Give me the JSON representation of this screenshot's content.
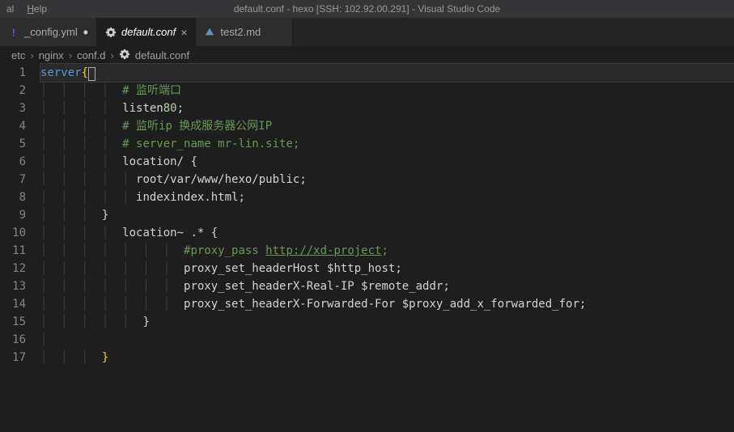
{
  "menu": {
    "item1": "al",
    "item2": "Help"
  },
  "title_center": "default.conf - hexo [SSH: 102.92.00.291] - Visual Studio Code",
  "tabs": [
    {
      "label": "_config.yml",
      "icon": "yaml",
      "active": false,
      "dirty": true
    },
    {
      "label": "default.conf",
      "icon": "gear",
      "active": true,
      "dirty": false
    },
    {
      "label": "test2.md",
      "icon": "md",
      "active": false,
      "dirty": false
    }
  ],
  "breadcrumb": [
    "etc",
    "nginx",
    "conf.d",
    "default.conf"
  ],
  "code": {
    "lines": [
      {
        "n": 1,
        "html": "<span class='tok-keyword'>server</span> <span class='tok-brace'>{</span><span class='cursor-box'></span>"
      },
      {
        "n": 2,
        "html": "<span class='indent-guides'>│  │  │  │  </span><span class='tok-comment'># 监听端口</span>"
      },
      {
        "n": 3,
        "html": "<span class='indent-guides'>│  │  │  │  </span><span class='tok-ident'>listen</span> <span class='tok-number'>80</span><span class='tok-semi'>;</span>"
      },
      {
        "n": 4,
        "html": "<span class='indent-guides'>│  │  │  │  </span><span class='tok-comment'># 监听ip 换成服务器公网IP</span>"
      },
      {
        "n": 5,
        "html": "<span class='indent-guides'>│  │  │  │  </span><span class='tok-comment'># server_name mr-lin.site;</span>"
      },
      {
        "n": 6,
        "html": "<span class='indent-guides'>│  │  │  │  </span><span class='tok-ident'>location</span> <span class='tok-plain'>/ {</span>"
      },
      {
        "n": 7,
        "html": "<span class='indent-guides'>│  │  │  │  │ </span><span class='tok-ident'>root</span> <span class='tok-plain'>/var/www/hexo/public</span><span class='tok-semi'>;</span>"
      },
      {
        "n": 8,
        "html": "<span class='indent-guides'>│  │  │  │  │ </span><span class='tok-ident'>index</span> <span class='tok-plain'>index.html</span><span class='tok-semi'>;</span>"
      },
      {
        "n": 9,
        "html": "<span class='indent-guides'>│  │  │  </span><span class='tok-plain'>}</span>"
      },
      {
        "n": 10,
        "html": "<span class='indent-guides'>│  │  │  │  </span><span class='tok-ident'>location</span> <span class='tok-plain'>~ .* {</span>"
      },
      {
        "n": 11,
        "html": "<span class='indent-guides'>│  │  │  │  │  │  │  </span><span class='tok-comment'>#proxy_pass </span><span class='tok-url'>http://xd-project</span><span class='tok-comment'>;</span>"
      },
      {
        "n": 12,
        "html": "<span class='indent-guides'>│  │  │  │  │  │  │  </span><span class='tok-ident'>proxy_set_header</span> <span class='tok-plain'>Host $http_host</span><span class='tok-semi'>;</span>"
      },
      {
        "n": 13,
        "html": "<span class='indent-guides'>│  │  │  │  │  │  │  </span><span class='tok-ident'>proxy_set_header</span> <span class='tok-plain'>X-Real-IP $remote_addr</span><span class='tok-semi'>;</span>"
      },
      {
        "n": 14,
        "html": "<span class='indent-guides'>│  │  │  │  │  │  │  </span><span class='tok-ident'>proxy_set_header</span> <span class='tok-plain'>X-Forwarded-For $proxy_add_x_forwarded_for</span><span class='tok-semi'>;</span>"
      },
      {
        "n": 15,
        "html": "<span class='indent-guides'>│  │  │  │  │  </span><span class='tok-plain'>}</span>"
      },
      {
        "n": 16,
        "html": "<span class='indent-guides'>│</span>"
      },
      {
        "n": 17,
        "html": "<span class='indent-guides'>│  │  │  </span><span class='tok-brace'>}</span>"
      }
    ]
  }
}
